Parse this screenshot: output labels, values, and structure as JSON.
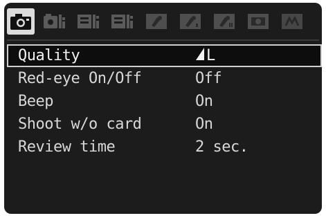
{
  "tabs": [
    {
      "icon": "camera-icon",
      "active": true
    },
    {
      "icon": "camera-playback-icon",
      "active": false
    },
    {
      "icon": "playback-icon-1",
      "active": false
    },
    {
      "icon": "playback-icon-2",
      "active": false
    },
    {
      "icon": "setup-icon-1",
      "active": false
    },
    {
      "icon": "setup-icon-2",
      "active": false
    },
    {
      "icon": "setup-icon-3",
      "active": false
    },
    {
      "icon": "custom-function-icon",
      "active": false
    },
    {
      "icon": "my-menu-icon",
      "active": false
    }
  ],
  "menu": {
    "items": [
      {
        "label": "Quality",
        "value": "L",
        "value_icon": "quality-fine-icon",
        "selected": true
      },
      {
        "label": "Red-eye On/Off",
        "value": "Off",
        "selected": false
      },
      {
        "label": "Beep",
        "value": "On",
        "selected": false
      },
      {
        "label": "Shoot w/o card",
        "value": "On",
        "selected": false
      },
      {
        "label": "Review time",
        "value": "2 sec.",
        "selected": false
      }
    ]
  },
  "colors": {
    "screen_bg": "#1c1c1c",
    "text": "#d8d8d8",
    "selection_border": "#d0d0d0",
    "active_tab_bg": "#dcdcdc",
    "inactive_tab": "#5a5a5a"
  }
}
